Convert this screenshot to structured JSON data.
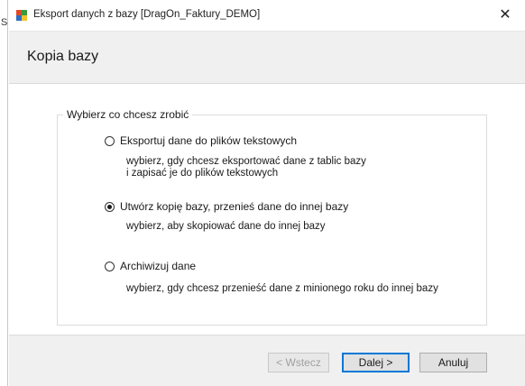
{
  "left_edge_letter": "S",
  "window": {
    "title": "Eksport danych z bazy [DragOn_Faktury_DEMO]",
    "close_symbol": "✕"
  },
  "header": {
    "title": "Kopia bazy"
  },
  "group": {
    "legend": "Wybierz co chcesz zrobić",
    "options": [
      {
        "label": "Eksportuj dane do plików tekstowych",
        "checked": false,
        "description_lines": [
          "wybierz, gdy chcesz eksportować dane z tablic bazy",
          "i zapisać je do plików tekstowych"
        ]
      },
      {
        "label": "Utwórz kopię bazy, przenieś dane do innej bazy",
        "checked": true,
        "description_lines": [
          "wybierz, aby skopiować dane do innej bazy"
        ]
      },
      {
        "label": "Archiwizuj dane",
        "checked": false,
        "description_lines": [
          "wybierz, gdy chcesz przenieść dane z minionego roku do innej bazy"
        ]
      }
    ]
  },
  "buttons": {
    "back": "< Wstecz",
    "next": "Dalej >",
    "cancel": "Anuluj"
  },
  "colors": {
    "header_bg": "#f0f0f0",
    "focus_border": "#0078d7"
  }
}
